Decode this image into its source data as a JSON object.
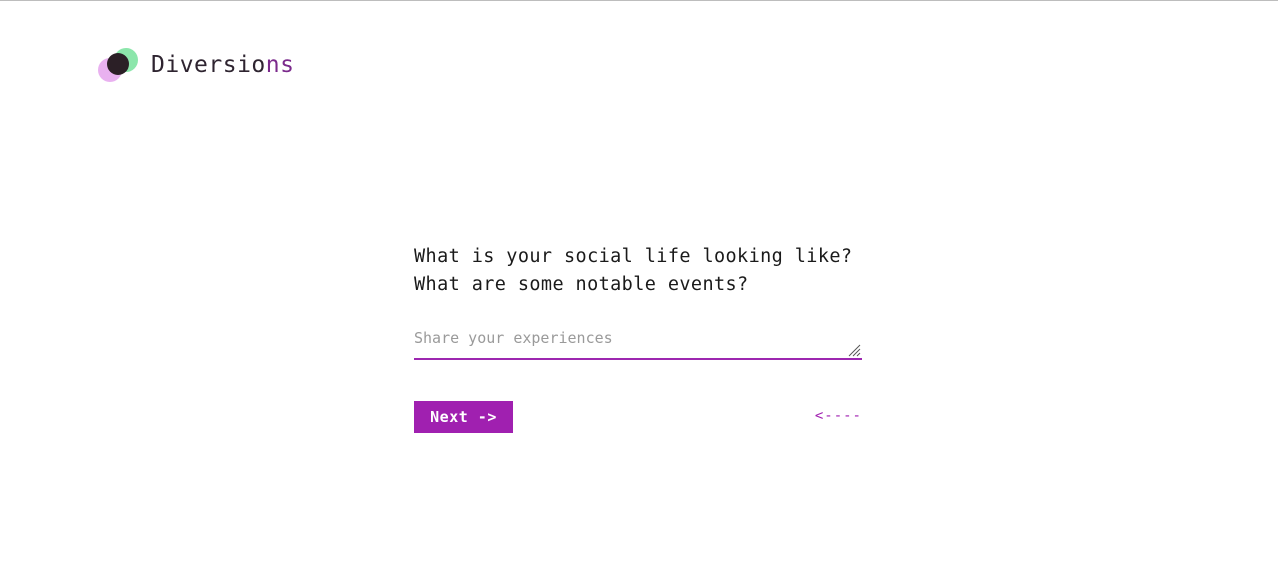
{
  "brand": {
    "name_main": "Diversio",
    "name_tail": "ns"
  },
  "prompt": {
    "question": "What is your social life looking like? What are some notable events?"
  },
  "answer": {
    "value": "",
    "placeholder": "Share your experiences"
  },
  "actions": {
    "next_label": "Next ->",
    "back_label": "<----"
  },
  "colors": {
    "accent": "#a020b0",
    "brand_dark": "#2b1f26",
    "brand_green": "#7fe3a2",
    "brand_pink": "#e7a9ee"
  },
  "icons": {
    "logo": "overlapping-circles-logo-icon",
    "resize": "resize-grip-icon"
  }
}
